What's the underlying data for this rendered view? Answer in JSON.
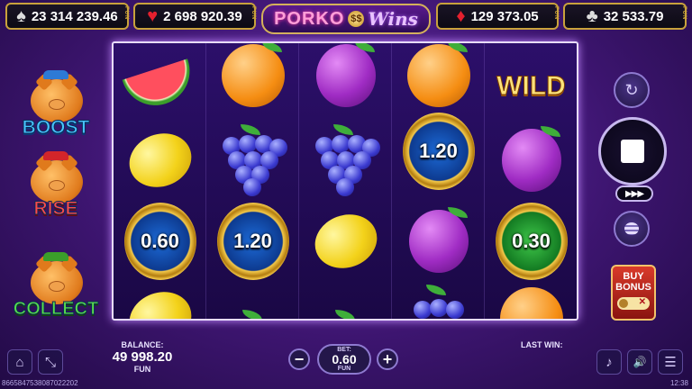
{
  "jackpots": {
    "spade": "23 314 239.46",
    "heart": "2 698 920.39",
    "diamond": "129 373.05",
    "club": "32 533.79",
    "fun_tag": "FUN"
  },
  "logo": {
    "part1": "PORKO",
    "coin": "$$",
    "part2": "Wins"
  },
  "features": {
    "boost": "BOOST",
    "rise": "RISE",
    "collect": "COLLECT"
  },
  "reels": [
    [
      "melon",
      "lemon",
      "coin:0.60",
      "partial"
    ],
    [
      "orange",
      "grapes",
      "coin:1.20",
      "partial"
    ],
    [
      "plum",
      "grapes",
      "lemon",
      "partial"
    ],
    [
      "orange",
      "coin:1.20",
      "plum",
      "grapes"
    ],
    [
      "wild",
      "plum",
      "coin:0.30",
      "partial"
    ]
  ],
  "symbols": {
    "wild_label": "WILD",
    "coin_values": [
      "0.60",
      "1.20",
      "1.20",
      "0.30"
    ]
  },
  "controls": {
    "turbo_label": "▶▶▶",
    "buy_bonus_line1": "BUY",
    "buy_bonus_line2": "BONUS",
    "buy_bonus_close": "✕"
  },
  "bottom": {
    "balance_label": "BALANCE:",
    "balance_value": "49 998.20",
    "balance_currency": "FUN",
    "bet_label": "BET:",
    "bet_value": "0.60",
    "bet_currency": "FUN",
    "minus": "−",
    "plus": "+",
    "last_win_label": "LAST WIN:"
  },
  "footer": {
    "session_id": "8665847538087022202",
    "time": "12:38"
  },
  "icons": {
    "home": "⌂",
    "fullscreen": "⤡",
    "music": "♪",
    "sound": "🔊",
    "menu": "☰",
    "autoplay": "↻"
  },
  "colors": {
    "accent": "#c9a23c",
    "background": "#3d1570"
  }
}
